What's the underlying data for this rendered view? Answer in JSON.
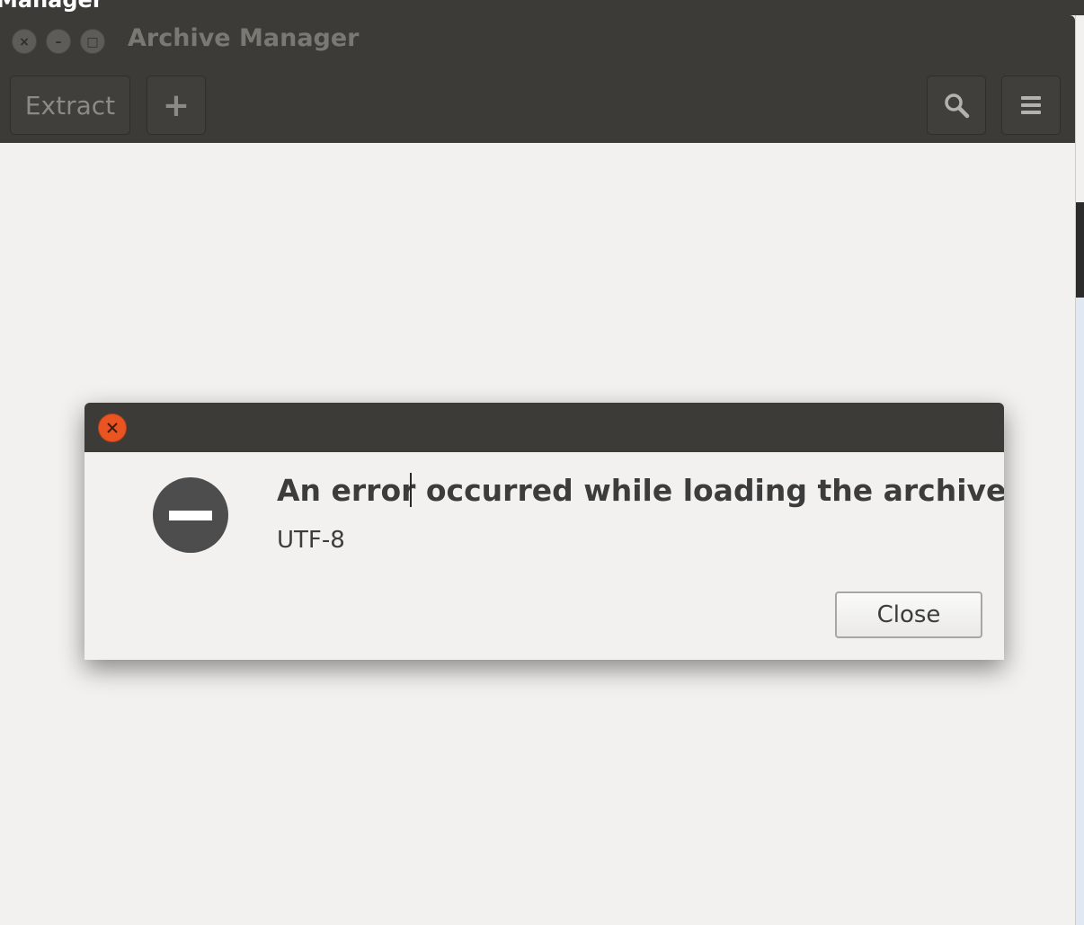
{
  "background_window": {
    "title": "Manager"
  },
  "window": {
    "title": "Archive Manager",
    "controls": {
      "close": "×",
      "minimize": "–",
      "maximize": "□"
    }
  },
  "toolbar": {
    "extract_label": "Extract",
    "add_label": "+",
    "search_icon": "search-icon",
    "menu_icon": "hamburger-menu-icon"
  },
  "dialog": {
    "close_glyph": "×",
    "message_primary": "An error occurred while loading the archive.",
    "message_secondary": "UTF-8",
    "close_button_label": "Close",
    "icon": "error-icon"
  },
  "colors": {
    "headerbar": "#3c3b37",
    "window_bg": "#f2f1f0",
    "close_accent": "#e95420"
  }
}
